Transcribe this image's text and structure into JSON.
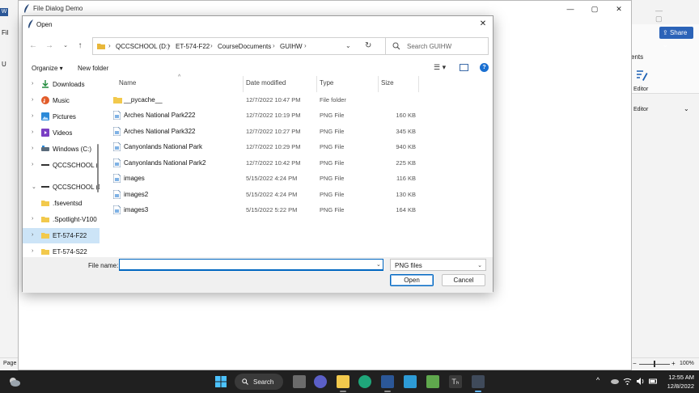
{
  "background_word": {
    "share_label": "Share",
    "tab_partial": "ents",
    "editor_label": "Editor",
    "editor_group": "Editor",
    "status_page": "Page",
    "zoom": "100%",
    "left_labels": [
      "Fil",
      "U"
    ]
  },
  "demo_window": {
    "title": "File Dialog Demo"
  },
  "dialog": {
    "title": "Open",
    "address": [
      "QCCSCHOOL (D:)",
      "ET-574-F22",
      "CourseDocuments",
      "GUIHW"
    ],
    "search_placeholder": "Search GUIHW",
    "organize_label": "Organize ▾",
    "new_folder_label": "New folder",
    "columns": {
      "name": "Name",
      "date": "Date modified",
      "type": "Type",
      "size": "Size"
    },
    "nav_items": [
      {
        "label": "Downloads",
        "icon": "download-icon",
        "color": "#1f8a3a"
      },
      {
        "label": "Music",
        "icon": "music-icon",
        "color": "#e25c2a"
      },
      {
        "label": "Pictures",
        "icon": "pictures-icon",
        "color": "#2c8ad8"
      },
      {
        "label": "Videos",
        "icon": "videos-icon",
        "color": "#7b3fc4"
      },
      {
        "label": "Windows (C:)",
        "icon": "drive-icon",
        "color": "#5a6b7b"
      },
      {
        "label": "QCCSCHOOL (",
        "icon": "drive-icon",
        "color": "#333333"
      },
      {
        "label": "QCCSCHOOL (D",
        "icon": "drive-icon",
        "color": "#333333"
      },
      {
        "label": ".fseventsd",
        "icon": "folder-icon",
        "color": "#f2c94c"
      },
      {
        "label": ".Spotlight-V100",
        "icon": "folder-icon",
        "color": "#f2c94c"
      },
      {
        "label": "ET-574-F22",
        "icon": "folder-icon",
        "color": "#f2c94c"
      },
      {
        "label": "ET-574-S22",
        "icon": "folder-icon",
        "color": "#f2c94c"
      }
    ],
    "files": [
      {
        "name": "__pycache__",
        "date": "12/7/2022 10:47 PM",
        "type": "File folder",
        "size": "",
        "kind": "folder"
      },
      {
        "name": "Arches National Park222",
        "date": "12/7/2022 10:19 PM",
        "type": "PNG File",
        "size": "160 KB",
        "kind": "png"
      },
      {
        "name": "Arches National Park322",
        "date": "12/7/2022 10:27 PM",
        "type": "PNG File",
        "size": "345 KB",
        "kind": "png"
      },
      {
        "name": "Canyonlands National Park",
        "date": "12/7/2022 10:29 PM",
        "type": "PNG File",
        "size": "940 KB",
        "kind": "png"
      },
      {
        "name": "Canyonlands National Park2",
        "date": "12/7/2022 10:42 PM",
        "type": "PNG File",
        "size": "225 KB",
        "kind": "png"
      },
      {
        "name": "images",
        "date": "5/15/2022 4:24 PM",
        "type": "PNG File",
        "size": "116 KB",
        "kind": "png"
      },
      {
        "name": "images2",
        "date": "5/15/2022 4:24 PM",
        "type": "PNG File",
        "size": "130 KB",
        "kind": "png"
      },
      {
        "name": "images3",
        "date": "5/15/2022 5:22 PM",
        "type": "PNG File",
        "size": "164 KB",
        "kind": "png"
      }
    ],
    "file_name_label": "File name:",
    "file_name_value": "",
    "file_type": "PNG files",
    "open_label": "Open",
    "cancel_label": "Cancel"
  },
  "taskbar": {
    "search_label": "Search",
    "time": "12:55 AM",
    "date": "12/8/2022"
  },
  "colors": {
    "accent": "#0067c0",
    "selection": "#cce4f7",
    "folder": "#f2c94c",
    "taskbar": "#202020"
  }
}
